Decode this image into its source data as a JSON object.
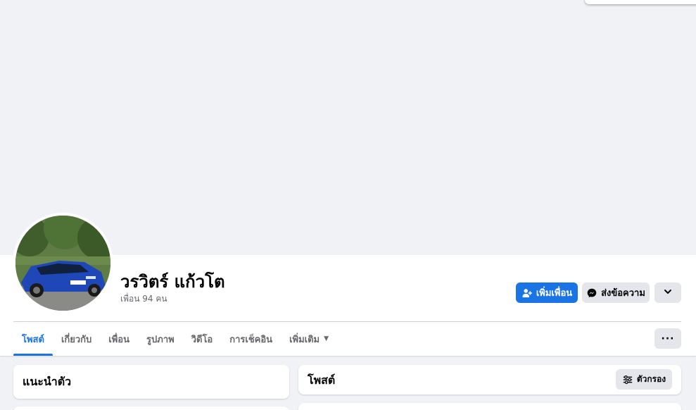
{
  "profile": {
    "name": "วรวิตร์ แก้วโต",
    "friends_count": "เพื่อน 94 คน"
  },
  "actions": {
    "add_friend": "เพิ่มเพื่อน",
    "message": "ส่งข้อความ"
  },
  "tabs": [
    {
      "label": "โพสต์",
      "active": true
    },
    {
      "label": "เกี่ยวกับ",
      "active": false
    },
    {
      "label": "เพื่อน",
      "active": false
    },
    {
      "label": "รูปภาพ",
      "active": false
    },
    {
      "label": "วิดีโอ",
      "active": false
    },
    {
      "label": "การเช็คอิน",
      "active": false
    },
    {
      "label": "เพิ่มเติม",
      "active": false
    }
  ],
  "tab_more_icon": "ellipsis-icon",
  "intro": {
    "title": "แนะนำตัว"
  },
  "posts": {
    "title": "โพสต์",
    "filter_label": "ตัวกรอง"
  },
  "colors": {
    "accent": "#1b74e4",
    "background": "#f0f2f5",
    "secondary_button": "#e4e6eb"
  }
}
